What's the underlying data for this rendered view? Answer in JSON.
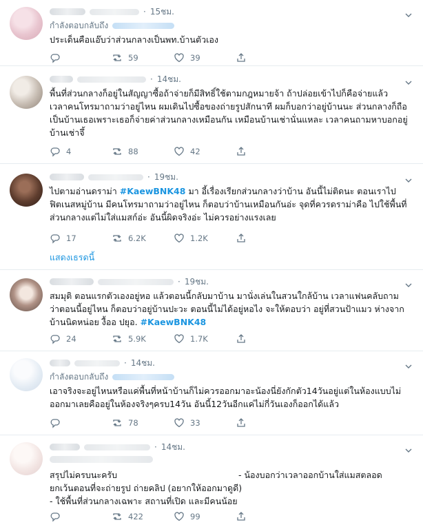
{
  "tweets": [
    {
      "time": "15ชม.",
      "replying_to": "กำลังตอบกลับถึง",
      "text": "ประเด็นคือแอ๊บว่าส่วนกลางเป็นพท.บ้านตัวเอง",
      "replies": "",
      "retweets": "59",
      "likes": "39"
    },
    {
      "time": "14ชม.",
      "text": "พื้นที่ส่วนกลางก็อยู่ในสัญญาซื้อถ้าจ่ายก็มีสิทธิ์ใช้ตามกฎหมายจ้า ถ้าปล่อยเข้าไปก็คือจ่ายแล้ว เวลาคนโทรมาถามว่าอยู่ไหน ผมเดินไปซื้อของถ่ายรูปสักนาที ผมก็บอกว่าอยู่บ้านนะ ส่วนกลางก็ถือเป็นบ้านเธอเพราะเธอก็จ่ายค่าส่วนกลางเหมือนกัน เหมือนบ้านเช่านั่นแหละ เวลาคนถามหาบอกอยู่บ้านเช่าจึ้",
      "replies": "4",
      "retweets": "88",
      "likes": "42"
    },
    {
      "time": "19ชม.",
      "text_before": "ไปตามอ่านดราม่า ",
      "hashtag": "#KaewBNK48",
      "text_after": " มา อี้เรื่องเรียกส่วนกลางว่าบ้าน อันนี้ไม่ติดนะ ตอนเราไปฟิตเนสหมู่บ้าน มีคนโทรมาถามว่าอยู่ไหน ก็ตอบว่าบ้านเหมือนกันอ่ะ จุดที่ควรดราม่าคือ ไปใช้พื้นที่ส่วนกลางแต่ไม่ใส่แมสก์อ่ะ อันนี้ผิดจริงอ่ะ ไม่ควรอย่างแรงเลย",
      "replies": "17",
      "retweets": "6.2K",
      "likes": "1.2K",
      "show_thread": "แสดงเธรดนี้"
    },
    {
      "time": "19ชม.",
      "text_before": "สมมุติ ตอนแรกตัวเองอยู่หอ แล้วตอนนี้กลับมาบ้าน มานั่งเล่นในสวนใกล้บ้าน เวลาแฟนคลับถามว่าตอนนี้อยู่ไหน ก็ตอบว่าอยู่บ้านปะวะ ตอนนี้ไม่ได้อยู่หอไง จะให้ตอบว่า อยู่ที่สวนป้าแมว ห่างจากบ้านนิดหน่อย งื้ออ ปยุอ. ",
      "hashtag": "#KaewBNK48",
      "replies": "24",
      "retweets": "5.9K",
      "likes": "1.7K"
    },
    {
      "time": "14ชม.",
      "replying_to": "กำลังตอบกลับถึง",
      "text": "เอาจริงจะอยู่ไหนหรือแค่พื้นที่หน้าบ้านก็ไม่ควรออกมาอะน้องนี่ยังกักตัว14วันอยู่แต่ในห้องแบบไม่ออกมาเลยคืออยู่ในห้องจริงๆครบ14วัน อันนี้12วันอีกแค่ไม่กี่วันเองก็ออกได้แล้ว",
      "replies": "",
      "retweets": "78",
      "likes": "33"
    },
    {
      "time": "14ชม.",
      "line1_left": "สรุปไม่ครบนะครับ",
      "line1_right": "- น้องบอกว่าเวลาออกบ้านใส่แมสตลอด",
      "line2": "ยกเว้นตอนที่จะถ่ายรูป ถ่ายคลิป (อยากให้ออกมาดูดี)",
      "line3": "- ใช้พื้นที่ส่วนกลางเฉพาะ สถานที่เปิด และมีคนน้อย",
      "replies": "",
      "retweets": "422",
      "likes": "99"
    }
  ],
  "icons": {
    "reply": "reply-icon",
    "retweet": "retweet-icon",
    "like": "heart-icon",
    "share": "share-icon",
    "menu": "chevron-down-icon"
  },
  "colors": {
    "text": "#14171a",
    "muted": "#657786",
    "link": "#1b95e0",
    "divider": "#e6ecf0"
  }
}
